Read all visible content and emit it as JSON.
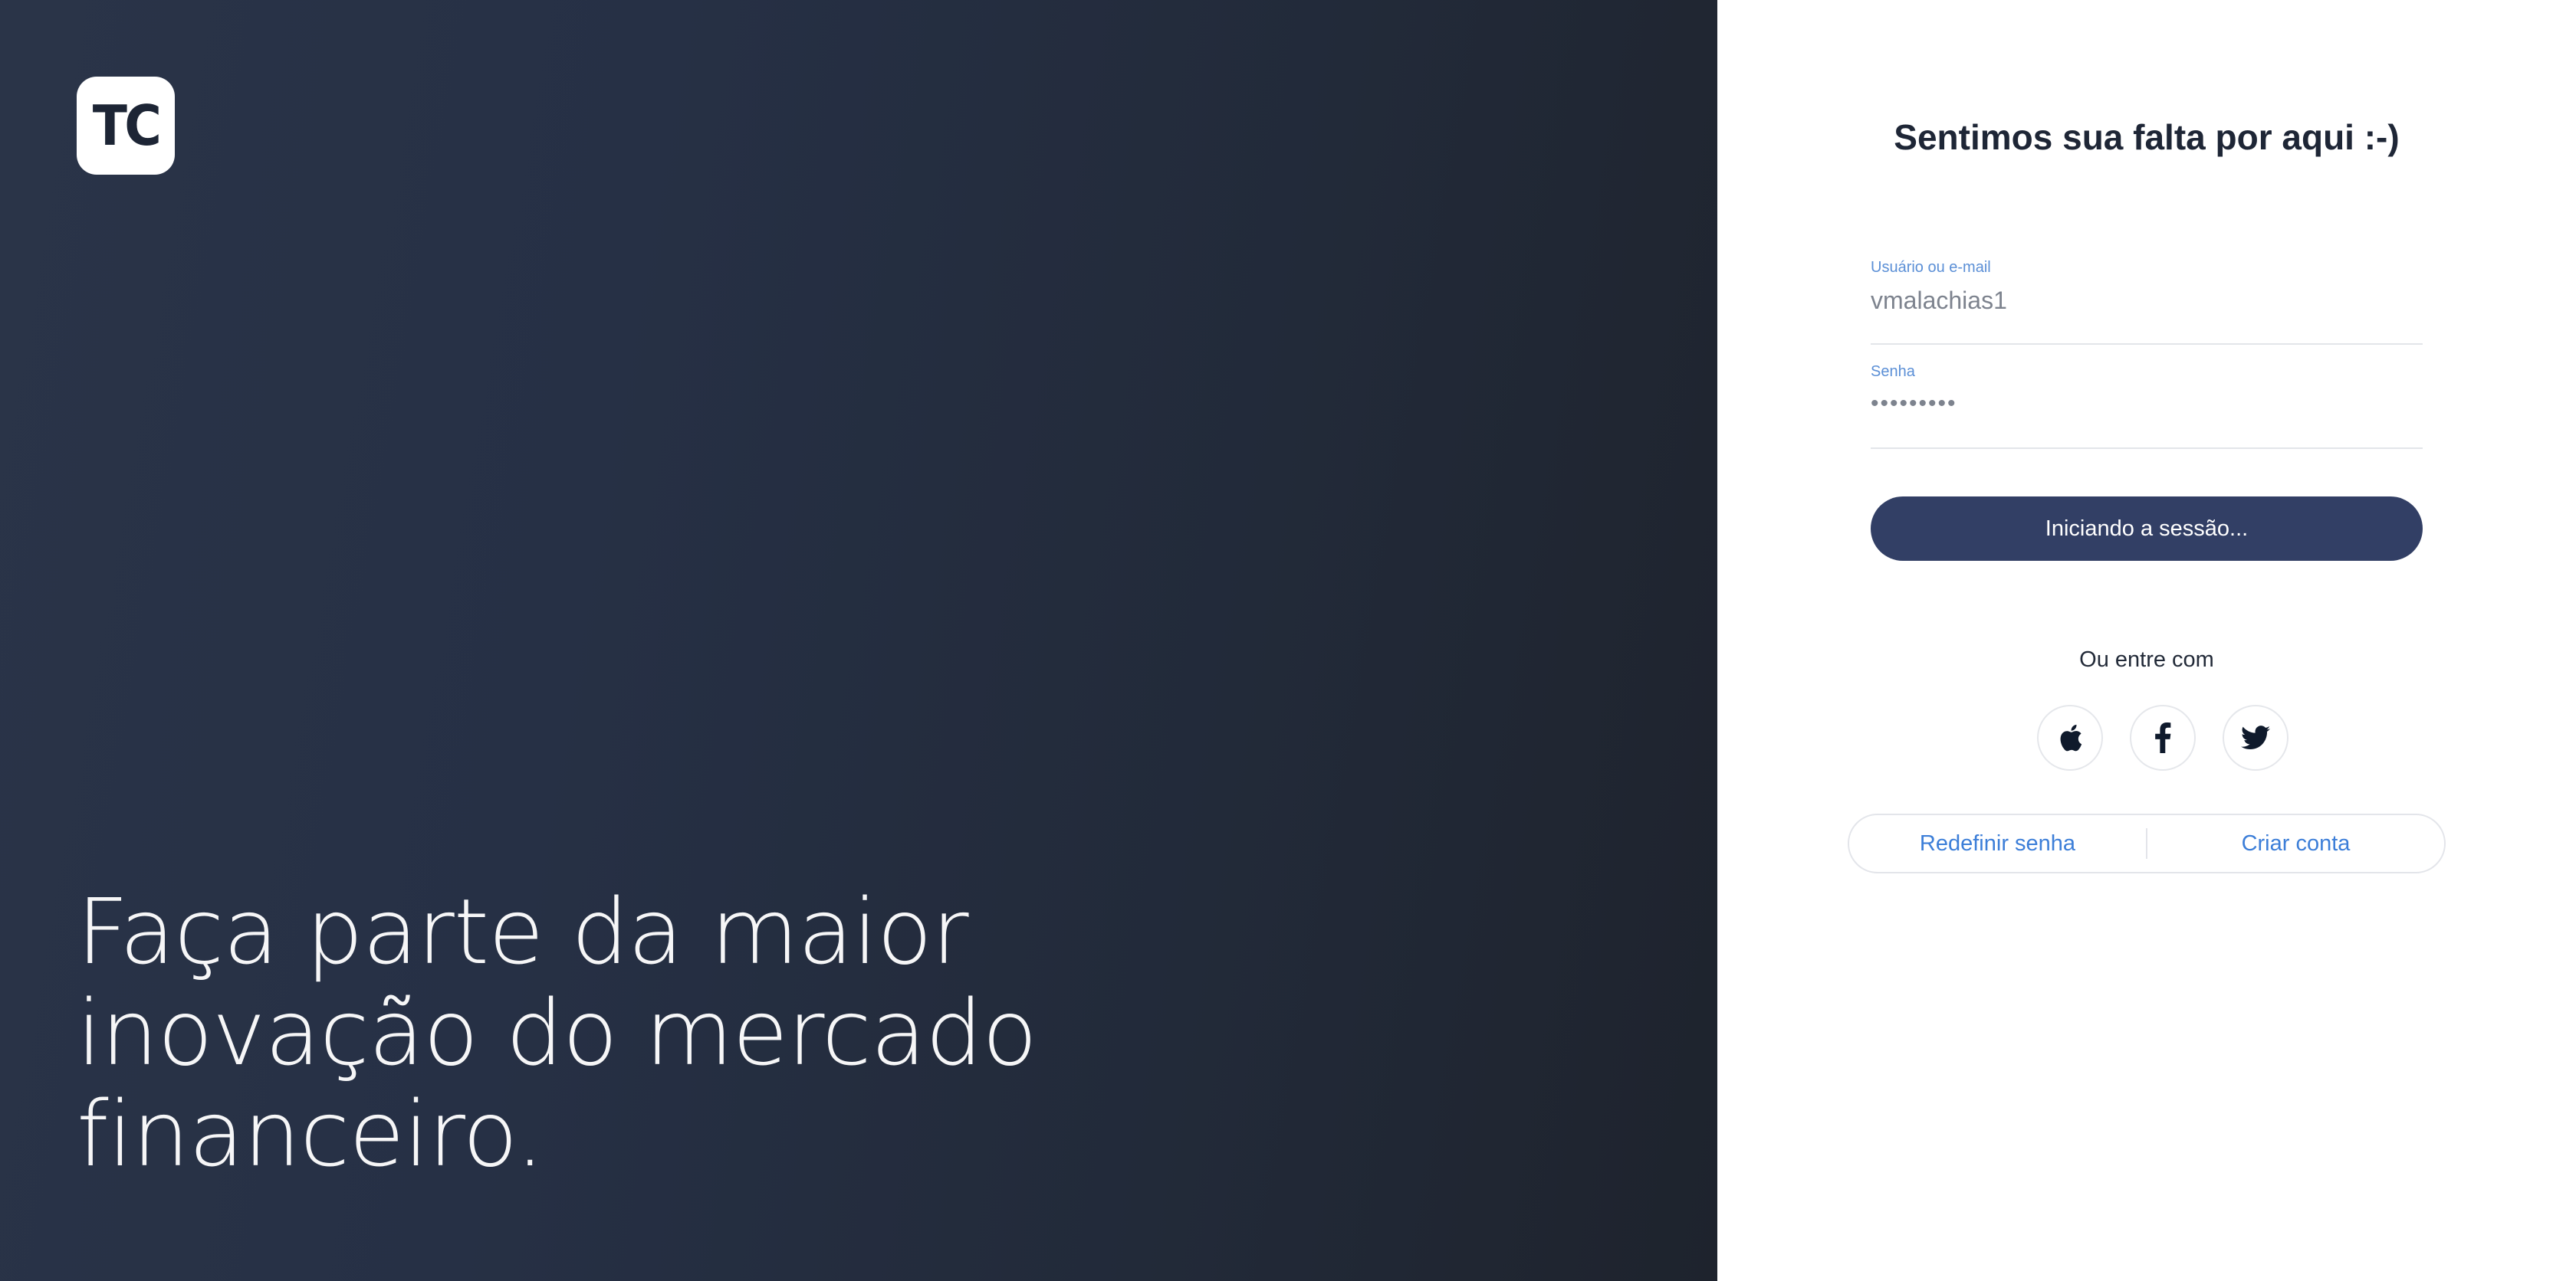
{
  "hero": {
    "logo_text": "TC",
    "headline_line1": "Faça parte da maior",
    "headline_line2": "inovação do mercado",
    "headline_line3": "financeiro."
  },
  "login": {
    "title": "Sentimos sua falta por aqui :-)",
    "username": {
      "label": "Usuário ou e-mail",
      "value": "vmalachias1"
    },
    "password": {
      "label": "Senha",
      "value": "•••••••••"
    },
    "submit_label": "Iniciando a sessão...",
    "alt_login_text": "Ou entre com",
    "social": [
      "apple-icon",
      "facebook-icon",
      "twitter-icon"
    ],
    "links": {
      "reset_password": "Redefinir senha",
      "create_account": "Criar conta"
    }
  },
  "colors": {
    "hero_bg": "#263045",
    "button_bg": "#323f65",
    "accent_link": "#3c7ed8",
    "label_blue": "#5b8fd6"
  }
}
